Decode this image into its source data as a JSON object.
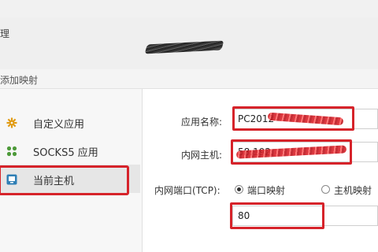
{
  "header": {
    "title_fragment": "理"
  },
  "dialog": {
    "title": "添加映射"
  },
  "sidebar": {
    "items": [
      {
        "label": "自定义应用",
        "icon": "gear-icon"
      },
      {
        "label": "SOCKS5 应用",
        "icon": "socks-dots-icon"
      },
      {
        "label": "当前主机",
        "icon": "monitor-icon",
        "selected": true
      }
    ]
  },
  "form": {
    "app_name_label": "应用名称:",
    "app_name_value": "PC2012",
    "host_label": "内网主机:",
    "host_value": "58.192.",
    "port_label": "内网端口(TCP):",
    "radio_port_mapping": "端口映射",
    "radio_host_mapping": "主机映射",
    "port_value": "80",
    "port_mode_selected": "端口映射"
  },
  "colors": {
    "highlight": "#d6232a",
    "tool_refresh": "#2a9a8a",
    "tool_delete": "#c8472f",
    "gear": "#e19b14",
    "dots": "#4e9a3a",
    "monitor": "#2f7fb5"
  }
}
